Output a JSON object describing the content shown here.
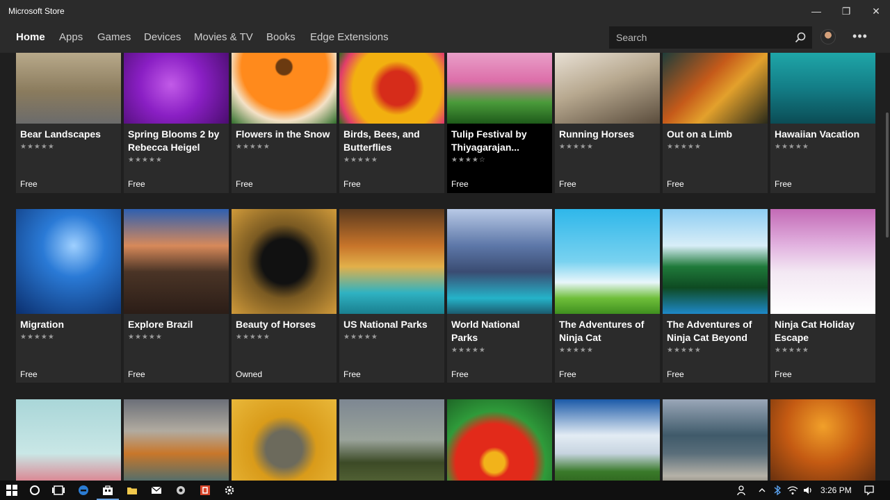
{
  "window": {
    "title": "Microsoft Store",
    "minimize_glyph": "—",
    "maximize_glyph": "❐",
    "close_glyph": "✕"
  },
  "nav": {
    "items": [
      "Home",
      "Apps",
      "Games",
      "Devices",
      "Movies & TV",
      "Books",
      "Edge Extensions"
    ],
    "active": "Home"
  },
  "search": {
    "placeholder": "Search",
    "value": ""
  },
  "tiles": [
    {
      "name": "Bear Landscapes",
      "stars": "★★★★★",
      "price": "Free"
    },
    {
      "name": "Spring Blooms 2 by Rebecca Heigel",
      "stars": "★★★★★",
      "price": "Free"
    },
    {
      "name": "Flowers in the Snow",
      "stars": "★★★★★",
      "price": "Free"
    },
    {
      "name": "Birds, Bees, and Butterflies",
      "stars": "★★★★★",
      "price": "Free"
    },
    {
      "name": "Tulip Festival by Thiyagarajan...",
      "stars": "★★★★☆",
      "price": "Free"
    },
    {
      "name": "Running Horses",
      "stars": "★★★★★",
      "price": "Free"
    },
    {
      "name": "Out on a Limb",
      "stars": "★★★★★",
      "price": "Free"
    },
    {
      "name": "Hawaiian Vacation",
      "stars": "★★★★★",
      "price": "Free"
    },
    {
      "name": "Migration",
      "stars": "★★★★★",
      "price": "Free"
    },
    {
      "name": "Explore Brazil",
      "stars": "★★★★★",
      "price": "Free"
    },
    {
      "name": "Beauty of Horses",
      "stars": "★★★★★",
      "price": "Owned"
    },
    {
      "name": "US National Parks",
      "stars": "★★★★★",
      "price": "Free"
    },
    {
      "name": "World National Parks",
      "stars": "★★★★★",
      "price": "Free"
    },
    {
      "name": "The Adventures of Ninja Cat",
      "stars": "★★★★★",
      "price": "Free"
    },
    {
      "name": "The Adventures of Ninja Cat Beyond",
      "stars": "★★★★★",
      "price": "Free"
    },
    {
      "name": "Ninja Cat Holiday Escape",
      "stars": "★★★★★",
      "price": "Free"
    }
  ],
  "taskbar": {
    "clock": "3:26 PM",
    "icons": [
      "start-icon",
      "cortana-icon",
      "task-view-icon",
      "edge-icon",
      "store-icon",
      "file-explorer-icon",
      "mail-icon",
      "app-icon",
      "app-red-icon",
      "settings-icon"
    ]
  },
  "colors": {
    "background": "#1f1f1f",
    "titlebar": "#2b2b2b",
    "tile": "#2b2b2b",
    "taskbar": "#101010"
  }
}
